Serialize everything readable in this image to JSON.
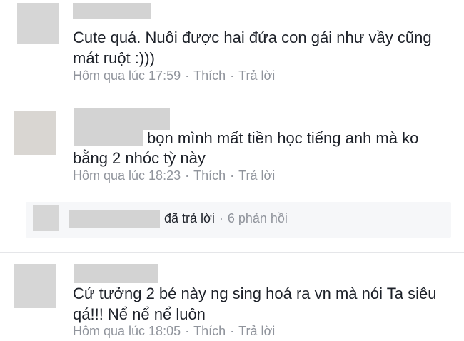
{
  "comments": [
    {
      "text_line1": "Cute quá. Nuôi được hai đứa con gái như vầy cũng",
      "text_line2": "mát ruột :)))",
      "time": "Hôm qua lúc 17:59",
      "like": "Thích",
      "reply": "Trả lời"
    },
    {
      "text_line1": "bọn mình mất  tiền học tiếng anh mà ko",
      "text_line2": "bằng 2 nhóc tỳ này",
      "time": "Hôm qua lúc 18:23",
      "like": "Thích",
      "reply": "Trả lời"
    },
    {
      "text_line1": "Cứ tưởng 2 bé này ng sing hoá ra vn mà nói Ta siêu",
      "text_line2": "qá!!! Nể nể nể luôn",
      "time": "Hôm qua lúc 18:05",
      "like": "Thích",
      "reply": "Trả lời"
    }
  ],
  "reply_summary": {
    "action": "đã trả lời",
    "count": "6 phản hồi"
  },
  "separator": "·"
}
